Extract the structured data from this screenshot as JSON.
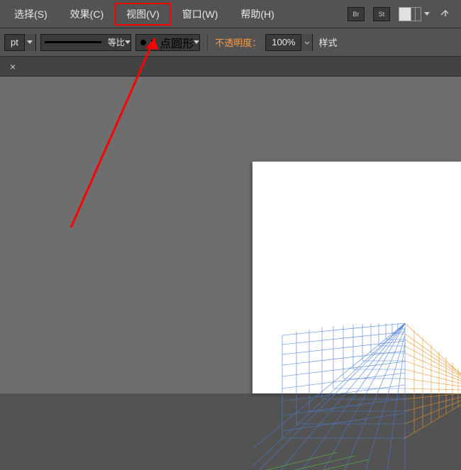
{
  "menubar": {
    "select": "选择(S)",
    "effect": "效果(C)",
    "view": "视图(V)",
    "window": "窗口(W)",
    "help": "帮助(H)",
    "br_icon": "Br",
    "st_icon": "St"
  },
  "options": {
    "unit": "pt",
    "stroke_label": "等比",
    "shape_label": "5 点圆形",
    "opacity_label": "不透明度：",
    "opacity_value": "100%",
    "style_label": "样式"
  },
  "tab": {
    "close": "×"
  }
}
